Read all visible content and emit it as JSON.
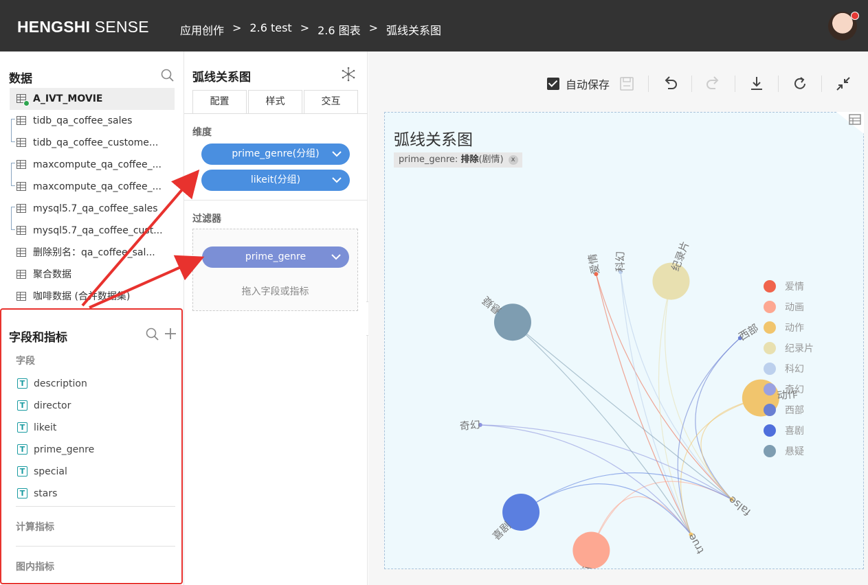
{
  "header": {
    "brand_bold": "HENGSHI",
    "brand_light": " SENSE",
    "breadcrumbs": [
      "应用创作",
      "2.6 test",
      "2.6 图表",
      "弧线关系图"
    ],
    "separator": ">"
  },
  "data_panel": {
    "title": "数据",
    "datasets": [
      {
        "label": "A_IVT_MOVIE",
        "active": true
      },
      {
        "label": "tidb_qa_coffee_sales"
      },
      {
        "label": "tidb_qa_coffee_custome..."
      },
      {
        "label": "maxcompute_qa_coffee_..."
      },
      {
        "label": "maxcompute_qa_coffee_..."
      },
      {
        "label": "mysql5.7_qa_coffee_sales"
      },
      {
        "label": "mysql5.7_qa_coffee_cust..."
      },
      {
        "label": "删除别名：qa_coffee_sal..."
      },
      {
        "label": "聚合数据"
      },
      {
        "label": "咖啡数据 (合并数据集)"
      }
    ]
  },
  "fields_panel": {
    "title": "字段和指标",
    "fields_heading": "字段",
    "fields": [
      "description",
      "director",
      "likeit",
      "prime_genre",
      "special",
      "stars"
    ],
    "field_type_glyph": "T",
    "calc_heading": "计算指标",
    "inchart_heading": "图内指标"
  },
  "config_panel": {
    "title": "弧线关系图",
    "tabs": [
      "配置",
      "样式",
      "交互"
    ],
    "dimension_heading": "维度",
    "dimensions": [
      "prime_genre(分组)",
      "likeit(分组)"
    ],
    "filter_heading": "过滤器",
    "filters": [
      "prime_genre"
    ],
    "drop_hint": "拖入字段或指标"
  },
  "toolbar": {
    "autosave_label": "自动保存",
    "autosave_checked": true
  },
  "chart_card": {
    "title": "弧线关系图",
    "filter_tag_field": "prime_genre: ",
    "filter_tag_op": "排除",
    "filter_tag_value": "(剧情)",
    "filter_tag_close": "x"
  },
  "chart_data": {
    "type": "arc-relation",
    "nodes": [
      {
        "name": "爱情",
        "size": "small",
        "color": "#ee6a4e"
      },
      {
        "name": "科幻",
        "size": "small",
        "color": "#b9cdea"
      },
      {
        "name": "纪录片",
        "size": "large",
        "color": "#e8e0b0"
      },
      {
        "name": "西部",
        "size": "small",
        "color": "#6a7fd2"
      },
      {
        "name": "动作",
        "size": "large",
        "color": "#f1c56d"
      },
      {
        "name": "false",
        "size": "small",
        "color": "#f1c56d"
      },
      {
        "name": "true",
        "size": "small",
        "color": "#f1c56d"
      },
      {
        "name": "动画",
        "size": "large",
        "color": "#fda892"
      },
      {
        "name": "喜剧",
        "size": "large",
        "color": "#5b7fe0"
      },
      {
        "name": "奇幻",
        "size": "small",
        "color": "#8d95de"
      },
      {
        "name": "悬疑",
        "size": "large",
        "color": "#7e9db1"
      }
    ],
    "legend": [
      {
        "name": "爱情",
        "color": "#f0644c"
      },
      {
        "name": "动画",
        "color": "#fda892"
      },
      {
        "name": "动作",
        "color": "#f1c56d"
      },
      {
        "name": "纪录片",
        "color": "#e8e0b0"
      },
      {
        "name": "科幻",
        "color": "#bcd0ed"
      },
      {
        "name": "奇幻",
        "color": "#9aa1e0"
      },
      {
        "name": "西部",
        "color": "#6a7fd2"
      },
      {
        "name": "喜剧",
        "color": "#4f6fdc"
      },
      {
        "name": "悬疑",
        "color": "#7e9db1"
      }
    ],
    "legend_position": "right"
  }
}
